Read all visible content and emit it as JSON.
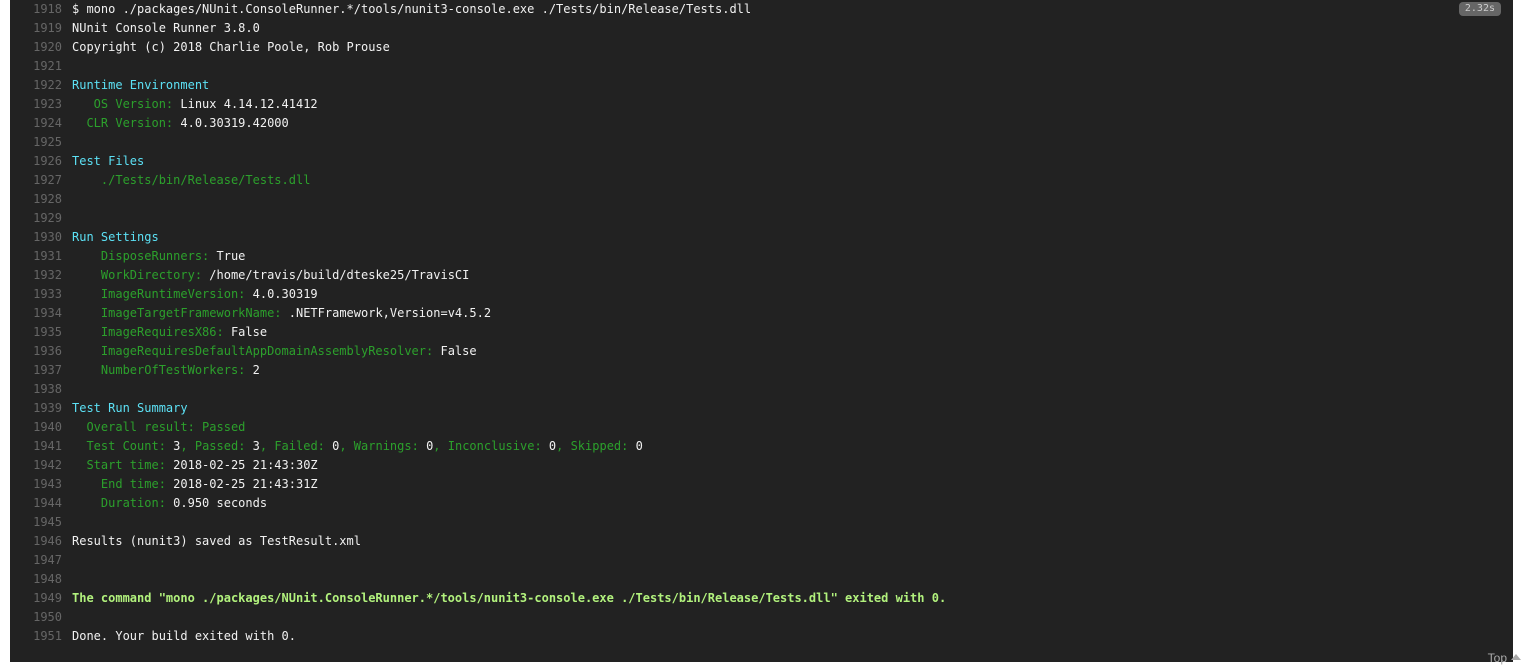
{
  "duration_badge": "2.32s",
  "top_link_label": "Top",
  "lines": [
    {
      "n": "1918",
      "segs": [
        {
          "t": "$ mono ./packages/NUnit.ConsoleRunner.*/tools/nunit3-console.exe ./Tests/bin/Release/Tests.dll",
          "c": "white"
        }
      ]
    },
    {
      "n": "1919",
      "segs": [
        {
          "t": "NUnit Console Runner 3.8.0",
          "c": "white"
        }
      ]
    },
    {
      "n": "1920",
      "segs": [
        {
          "t": "Copyright (c) 2018 Charlie Poole, Rob Prouse",
          "c": "white"
        }
      ]
    },
    {
      "n": "1921",
      "segs": []
    },
    {
      "n": "1922",
      "segs": [
        {
          "t": "Runtime Environment",
          "c": "cyan"
        }
      ]
    },
    {
      "n": "1923",
      "segs": [
        {
          "t": "   OS Version: ",
          "c": "green"
        },
        {
          "t": "Linux 4.14.12.41412",
          "c": "white"
        }
      ]
    },
    {
      "n": "1924",
      "segs": [
        {
          "t": "  CLR Version: ",
          "c": "green"
        },
        {
          "t": "4.0.30319.42000",
          "c": "white"
        }
      ]
    },
    {
      "n": "1925",
      "segs": []
    },
    {
      "n": "1926",
      "segs": [
        {
          "t": "Test Files",
          "c": "cyan"
        }
      ]
    },
    {
      "n": "1927",
      "segs": [
        {
          "t": "    ./Tests/bin/Release/Tests.dll",
          "c": "green"
        }
      ]
    },
    {
      "n": "1928",
      "segs": []
    },
    {
      "n": "1929",
      "segs": []
    },
    {
      "n": "1930",
      "segs": [
        {
          "t": "Run Settings",
          "c": "cyan"
        }
      ]
    },
    {
      "n": "1931",
      "segs": [
        {
          "t": "    DisposeRunners: ",
          "c": "green"
        },
        {
          "t": "True",
          "c": "white"
        }
      ]
    },
    {
      "n": "1932",
      "segs": [
        {
          "t": "    WorkDirectory: ",
          "c": "green"
        },
        {
          "t": "/home/travis/build/dteske25/TravisCI",
          "c": "white"
        }
      ]
    },
    {
      "n": "1933",
      "segs": [
        {
          "t": "    ImageRuntimeVersion: ",
          "c": "green"
        },
        {
          "t": "4.0.30319",
          "c": "white"
        }
      ]
    },
    {
      "n": "1934",
      "segs": [
        {
          "t": "    ImageTargetFrameworkName: ",
          "c": "green"
        },
        {
          "t": ".NETFramework,Version=v4.5.2",
          "c": "white"
        }
      ]
    },
    {
      "n": "1935",
      "segs": [
        {
          "t": "    ImageRequiresX86: ",
          "c": "green"
        },
        {
          "t": "False",
          "c": "white"
        }
      ]
    },
    {
      "n": "1936",
      "segs": [
        {
          "t": "    ImageRequiresDefaultAppDomainAssemblyResolver: ",
          "c": "green"
        },
        {
          "t": "False",
          "c": "white"
        }
      ]
    },
    {
      "n": "1937",
      "segs": [
        {
          "t": "    NumberOfTestWorkers: ",
          "c": "green"
        },
        {
          "t": "2",
          "c": "white"
        }
      ]
    },
    {
      "n": "1938",
      "segs": []
    },
    {
      "n": "1939",
      "segs": [
        {
          "t": "Test Run Summary",
          "c": "cyan"
        }
      ]
    },
    {
      "n": "1940",
      "segs": [
        {
          "t": "  Overall result: Passed",
          "c": "green"
        }
      ]
    },
    {
      "n": "1941",
      "segs": [
        {
          "t": "  Test Count: ",
          "c": "green"
        },
        {
          "t": "3",
          "c": "white"
        },
        {
          "t": ", Passed: ",
          "c": "green"
        },
        {
          "t": "3",
          "c": "white"
        },
        {
          "t": ", Failed: ",
          "c": "green"
        },
        {
          "t": "0",
          "c": "white"
        },
        {
          "t": ", Warnings: ",
          "c": "green"
        },
        {
          "t": "0",
          "c": "white"
        },
        {
          "t": ", Inconclusive: ",
          "c": "green"
        },
        {
          "t": "0",
          "c": "white"
        },
        {
          "t": ", Skipped: ",
          "c": "green"
        },
        {
          "t": "0",
          "c": "white"
        }
      ]
    },
    {
      "n": "1942",
      "segs": [
        {
          "t": "  Start time: ",
          "c": "green"
        },
        {
          "t": "2018-02-25 21:43:30Z",
          "c": "white"
        }
      ]
    },
    {
      "n": "1943",
      "segs": [
        {
          "t": "    End time: ",
          "c": "green"
        },
        {
          "t": "2018-02-25 21:43:31Z",
          "c": "white"
        }
      ]
    },
    {
      "n": "1944",
      "segs": [
        {
          "t": "    Duration: ",
          "c": "green"
        },
        {
          "t": "0.950 seconds",
          "c": "white"
        }
      ]
    },
    {
      "n": "1945",
      "segs": []
    },
    {
      "n": "1946",
      "segs": [
        {
          "t": "Results (nunit3) saved as TestResult.xml",
          "c": "white"
        }
      ]
    },
    {
      "n": "1947",
      "segs": []
    },
    {
      "n": "1948",
      "segs": []
    },
    {
      "n": "1949",
      "segs": [
        {
          "t": "The command \"mono ./packages/NUnit.ConsoleRunner.*/tools/nunit3-console.exe ./Tests/bin/Release/Tests.dll\" exited with 0.",
          "c": "lime"
        }
      ]
    },
    {
      "n": "1950",
      "segs": []
    },
    {
      "n": "1951",
      "segs": [
        {
          "t": "Done. Your build exited with 0.",
          "c": "white"
        }
      ]
    }
  ]
}
